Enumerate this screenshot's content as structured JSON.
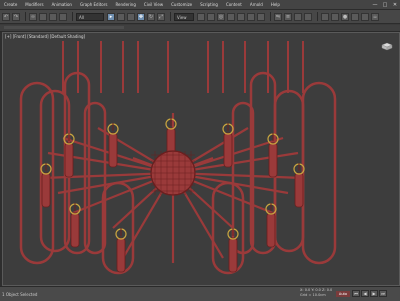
{
  "menus": [
    "Create",
    "Modifiers",
    "Animation",
    "Graph Editors",
    "Rendering",
    "Civil View",
    "Customize",
    "Scripting",
    "Content",
    "Arnold",
    "Help"
  ],
  "window_controls": [
    "—",
    "□",
    "✕"
  ],
  "toolbar": {
    "buttons": [
      "undo-icon",
      "redo-icon",
      "link-icon",
      "unlink-icon",
      "bind-icon",
      "filter-icon",
      "select-icon",
      "select-region-icon",
      "window-crossing-icon",
      "move-icon",
      "rotate-icon",
      "scale-icon",
      "view-icon",
      "pivot-icon",
      "snap-icon",
      "angle-snap-icon",
      "percent-snap-icon",
      "spinner-snap-icon",
      "edit-named-sets-icon",
      "mirror-icon",
      "align-icon",
      "layer-icon",
      "graphite-icon",
      "curve-editor-icon",
      "schematic-icon",
      "material-editor-icon",
      "render-setup-icon",
      "render-frame-icon",
      "render-icon"
    ],
    "selection_filter": "All",
    "view_dropdown": "View"
  },
  "viewport": {
    "label": "[+] [Front] [Standard] [Default Shading]"
  },
  "status": {
    "objects_selected": "1 Object Selected",
    "coords": "X: 0.0   Y: 0.0   Z: 0.0",
    "grid": "Grid = 10.0cm",
    "autokey_label": "Auto",
    "playback": [
      "⏮",
      "◀",
      "▶",
      "⏭"
    ]
  },
  "colors": {
    "model": "#9a3a3a",
    "model_dark": "#6a1f1f",
    "bulb": "#c9a640",
    "accent": "#6f8fb0"
  }
}
